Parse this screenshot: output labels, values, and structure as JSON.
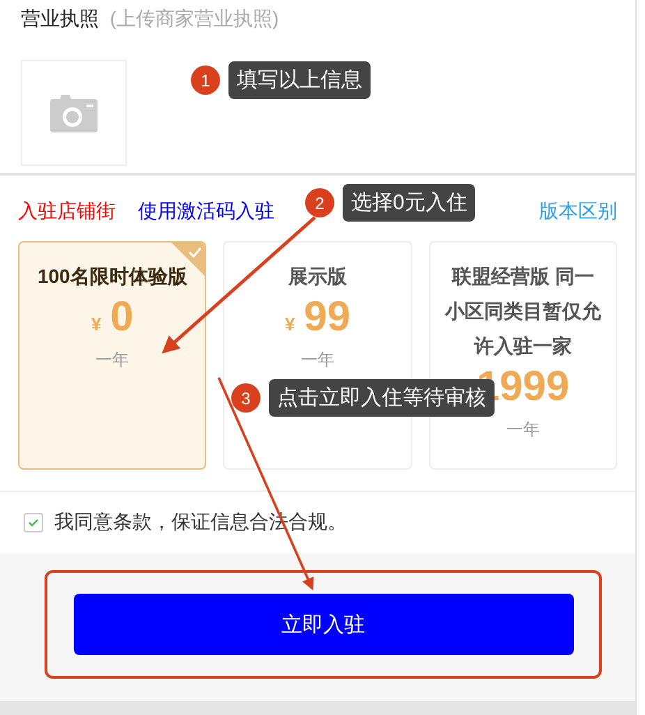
{
  "license": {
    "title": "营业执照",
    "hint": "(上传商家营业执照)"
  },
  "tabs": [
    {
      "label": "入驻店铺街",
      "selected": true
    },
    {
      "label": "使用激活码入驻",
      "selected": false
    }
  ],
  "compare_link": "版本区别",
  "plans": [
    {
      "name": "100名限时体验版",
      "currency": "¥",
      "price": "0",
      "period": "一年",
      "selected": true
    },
    {
      "name": "展示版",
      "currency": "¥",
      "price": "99",
      "period": "一年",
      "selected": false
    },
    {
      "name": "联盟经营版 同一小区同类目暂仅允许入驻一家",
      "price": "1999",
      "period": "一年",
      "selected": false
    }
  ],
  "agreement": {
    "label": "我同意条款，保证信息合法合规。",
    "checked": true
  },
  "submit_button": "立即入驻",
  "annotations": [
    {
      "number": "1",
      "text": "填写以上信息"
    },
    {
      "number": "2",
      "text": "选择0元入住"
    },
    {
      "number": "3",
      "text": "点击立即入住等待审核"
    }
  ]
}
